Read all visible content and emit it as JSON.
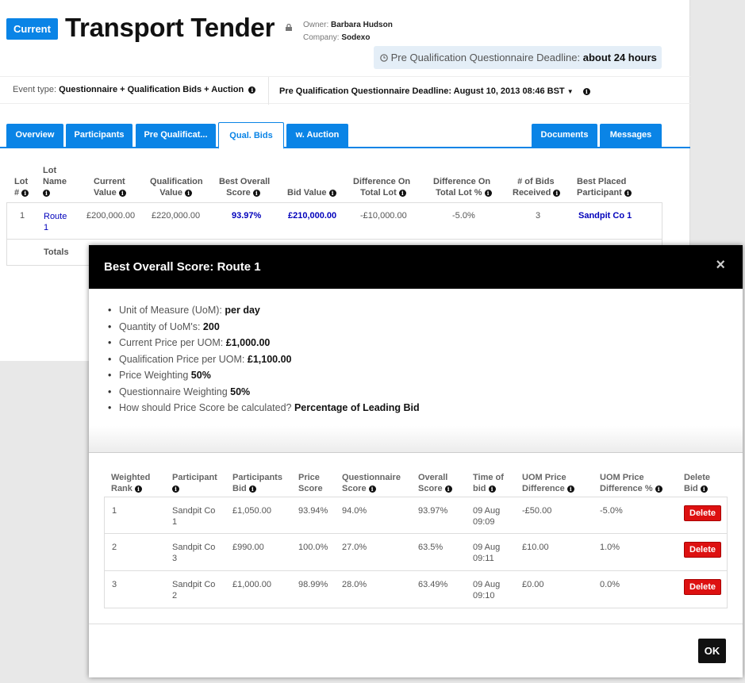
{
  "header": {
    "status_badge": "Current",
    "title": "Transport Tender",
    "owner_label": "Owner:",
    "owner_name": "Barbara Hudson",
    "company_label": "Company:",
    "company_name": "Sodexo",
    "deadline_label": "Pre Qualification Questionnaire Deadline:",
    "deadline_value": "about 24 hours"
  },
  "infobar": {
    "event_type_label": "Event type:",
    "event_type_value": "Questionnaire + Qualification Bids + Auction",
    "pq_deadline": "Pre Qualification Questionnaire Deadline: August 10, 2013 08:46 BST"
  },
  "tabs": [
    "Overview",
    "Participants",
    "Pre Qualificat...",
    "Qual. Bids",
    "w. Auction",
    "Documents",
    "Messages"
  ],
  "lots_table": {
    "headers": {
      "lot_line1": "Lot",
      "lot_line2": "#",
      "name_line1": "Lot",
      "name_line2": "Name",
      "cv_line1": "Current",
      "cv_line2": "Value",
      "qv_line1": "Qualification",
      "qv_line2": "Value",
      "bos_line1": "Best Overall",
      "bos_line2": "Score",
      "bid_value": "Bid Value",
      "dtl_line1": "Difference On",
      "dtl_line2": "Total Lot",
      "dtlp_line1": "Difference On",
      "dtlp_line2": "Total Lot %",
      "nb_line1": "# of Bids",
      "nb_line2": "Received",
      "bpp_line1": "Best Placed",
      "bpp_line2": "Participant"
    },
    "row": {
      "lot": "1",
      "name_line1": "Route",
      "name_line2": "1",
      "current_value": "£200,000.00",
      "qualification_value": "£220,000.00",
      "best_overall_score": "93.97%",
      "bid_value": "£210,000.00",
      "diff_total": "-£10,000.00",
      "diff_total_pct": "-5.0%",
      "num_bids": "3",
      "best_participant": "Sandpit Co 1"
    },
    "totals_label": "Totals"
  },
  "modal": {
    "title": "Best Overall Score: Route 1",
    "close": "×",
    "details": [
      {
        "label": "Unit of Measure (UoM):",
        "value": "per day"
      },
      {
        "label": "Quantity of UoM's:",
        "value": "200"
      },
      {
        "label": "Current Price per UOM:",
        "value": "£1,000.00"
      },
      {
        "label": "Qualification Price per UOM:",
        "value": "£1,100.00"
      },
      {
        "label": "Price Weighting",
        "value": "50%"
      },
      {
        "label": "Questionnaire Weighting",
        "value": "50%"
      },
      {
        "label": "How should Price Score be calculated?",
        "value": "Percentage of Leading Bid"
      }
    ],
    "bids_headers": {
      "rank_line1": "Weighted",
      "rank_line2": "Rank",
      "participant": "Participant",
      "pbid_line1": "Participants",
      "pbid_line2": "Bid",
      "ps_line1": "Price",
      "ps_line2": "Score",
      "qs_line1": "Questionnaire",
      "qs_line2": "Score",
      "os_line1": "Overall",
      "os_line2": "Score",
      "tob_line1": "Time of",
      "tob_line2": "bid",
      "upd_line1": "UOM Price",
      "upd_line2": "Difference",
      "updp_line1": "UOM Price",
      "updp_line2": "Difference %",
      "del_line1": "Delete",
      "del_line2": "Bid"
    },
    "bids": [
      {
        "rank": "1",
        "participant_line1": "Sandpit Co",
        "participant_line2": "1",
        "bid": "£1,050.00",
        "price_score": "93.94%",
        "questionnaire_score": "94.0%",
        "overall_score": "93.97%",
        "time_line1": "09 Aug",
        "time_line2": "09:09",
        "uom_diff": "-£50.00",
        "uom_diff_pct": "-5.0%",
        "delete": "Delete"
      },
      {
        "rank": "2",
        "participant_line1": "Sandpit Co",
        "participant_line2": "3",
        "bid": "£990.00",
        "price_score": "100.0%",
        "questionnaire_score": "27.0%",
        "overall_score": "63.5%",
        "time_line1": "09 Aug",
        "time_line2": "09:11",
        "uom_diff": "£10.00",
        "uom_diff_pct": "1.0%",
        "delete": "Delete"
      },
      {
        "rank": "3",
        "participant_line1": "Sandpit Co",
        "participant_line2": "2",
        "bid": "£1,000.00",
        "price_score": "98.99%",
        "questionnaire_score": "28.0%",
        "overall_score": "63.49%",
        "time_line1": "09 Aug",
        "time_line2": "09:10",
        "uom_diff": "£0.00",
        "uom_diff_pct": "0.0%",
        "delete": "Delete"
      }
    ],
    "ok": "OK"
  }
}
